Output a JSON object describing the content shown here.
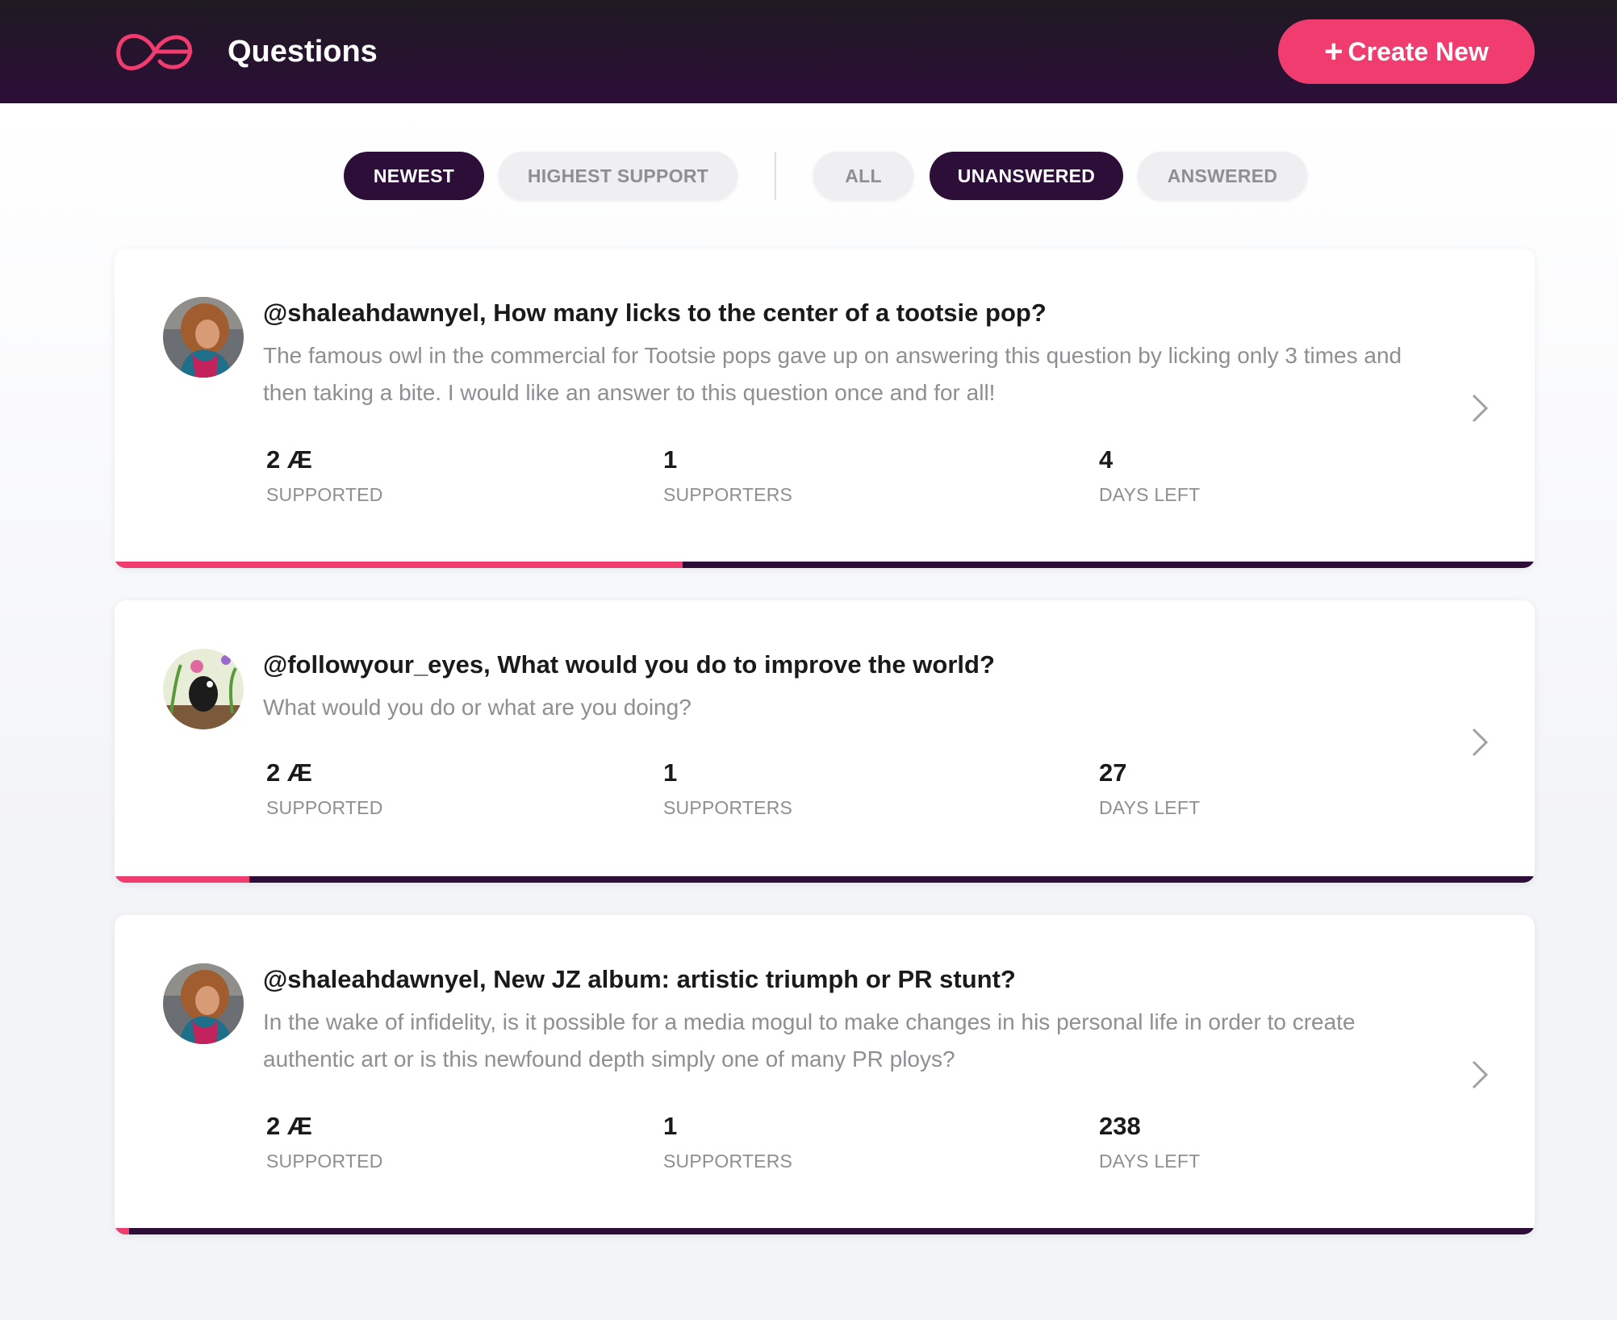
{
  "header": {
    "title": "Questions",
    "create_label": "Create New",
    "colors": {
      "background": "#2c0e38",
      "accent": "#f03c6e"
    }
  },
  "filters": {
    "sort": [
      {
        "label": "NEWEST",
        "active": true
      },
      {
        "label": "HIGHEST SUPPORT",
        "active": false
      }
    ],
    "status": [
      {
        "label": "ALL",
        "active": false
      },
      {
        "label": "UNANSWERED",
        "active": true
      },
      {
        "label": "ANSWERED",
        "active": false
      }
    ]
  },
  "questions": [
    {
      "title": "@shaleahdawnyel, How many licks to the center of a tootsie pop?",
      "body": "The famous owl in the commercial for Tootsie pops gave up on answering this question by licking only 3 times and then taking a bite. I would like an answer to this question once and for all!",
      "stats": {
        "supported": "2 Æ",
        "supported_label": "SUPPORTED",
        "supporters": "1",
        "supporters_label": "SUPPORTERS",
        "days_left": "4",
        "days_left_label": "DAYS LEFT"
      },
      "progress": 0.4
    },
    {
      "title": "@followyour_eyes, What would you do to improve the world?",
      "body": "What would you do or what are you doing?",
      "stats": {
        "supported": "2 Æ",
        "supported_label": "SUPPORTED",
        "supporters": "1",
        "supporters_label": "SUPPORTERS",
        "days_left": "27",
        "days_left_label": "DAYS LEFT"
      },
      "progress": 0.095
    },
    {
      "title": "@shaleahdawnyel, New JZ album: artistic triumph or PR stunt?",
      "body": "In the wake of infidelity, is it possible for a media mogul to make changes in his personal life in order to create authentic art or is this newfound depth simply one of many PR ploys?",
      "stats": {
        "supported": "2 Æ",
        "supported_label": "SUPPORTED",
        "supporters": "1",
        "supporters_label": "SUPPORTERS",
        "days_left": "238",
        "days_left_label": "DAYS LEFT"
      },
      "progress": 0.01
    }
  ]
}
